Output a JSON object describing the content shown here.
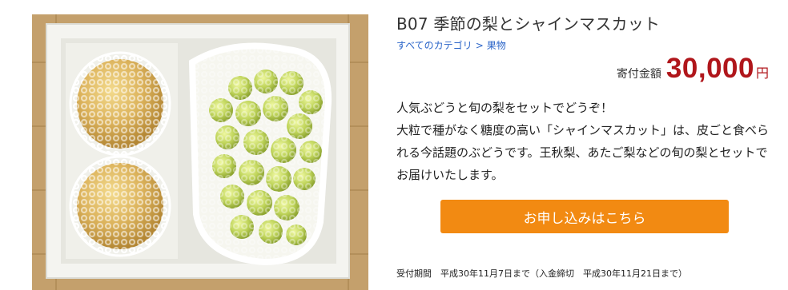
{
  "product": {
    "title": "B07 季節の梨とシャインマスカット",
    "image_alt": "梨とシャインマスカットの詰め合わせ"
  },
  "breadcrumb": {
    "items": [
      "すべてのカテゴリ",
      "果物"
    ],
    "separator": ">"
  },
  "price": {
    "label": "寄付金額",
    "amount": "30,000",
    "unit": "円"
  },
  "description": {
    "lines": [
      "人気ぶどうと旬の梨をセットでどうぞ！",
      "大粒で種がなく糖度の高い「シャインマスカット」は、皮ごと食べられる今話題のぶどうです。王秋梨、あたご梨などの旬の梨とセットでお届けいたします。"
    ]
  },
  "apply_button": {
    "label": "お申し込みはこちら"
  },
  "period": {
    "text": "受付期間　平成30年11月7日まで（入金締切　平成30年11月21日まで）"
  },
  "colors": {
    "accent_button": "#f28a12",
    "price": "#b0161b",
    "link": "#2a64c8"
  }
}
